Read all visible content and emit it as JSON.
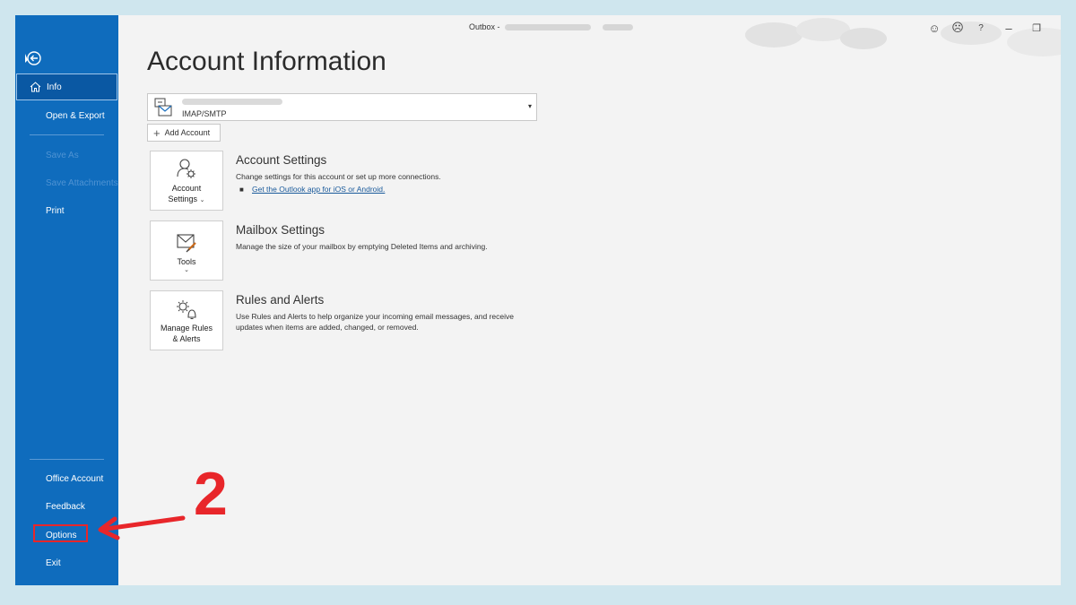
{
  "window": {
    "title_prefix": "Outbox -",
    "titlebar_icons": [
      {
        "name": "smiley-icon",
        "glyph": "☺"
      },
      {
        "name": "frown-icon",
        "glyph": "☹"
      },
      {
        "name": "help-icon",
        "glyph": "?"
      },
      {
        "name": "minimize-icon",
        "glyph": "–"
      },
      {
        "name": "restore-icon",
        "glyph": "❐"
      }
    ]
  },
  "sidebar": {
    "back_icon": "back-arrow-icon",
    "items": [
      {
        "label": "Info",
        "active": true
      },
      {
        "label": "Open & Export"
      },
      {
        "label": "Save As",
        "disabled": true
      },
      {
        "label": "Save Attachments",
        "disabled": true
      },
      {
        "label": "Print"
      }
    ],
    "bottom_items": [
      {
        "label": "Office Account"
      },
      {
        "label": "Feedback"
      },
      {
        "label": "Options",
        "highlighted": true
      },
      {
        "label": "Exit"
      }
    ]
  },
  "main": {
    "title": "Account Information",
    "account": {
      "type": "IMAP/SMTP"
    },
    "add_account_label": "Add Account",
    "sections": [
      {
        "tile_label_1": "Account",
        "tile_label_2": "Settings",
        "title": "Account Settings",
        "description": "Change settings for this account or set up more connections.",
        "link": "Get the Outlook app for iOS or Android."
      },
      {
        "tile_label_1": "Tools",
        "title": "Mailbox Settings",
        "description": "Manage the size of your mailbox by emptying Deleted Items and archiving."
      },
      {
        "tile_label_1": "Manage Rules",
        "tile_label_2": "& Alerts",
        "title": "Rules and Alerts",
        "description": "Use Rules and Alerts to help organize your incoming email messages, and receive updates when items are added, changed, or removed."
      }
    ]
  },
  "annotation": {
    "number": "2",
    "color": "#e8262a"
  },
  "colors": {
    "sidebar_bg": "#0f6cbd",
    "page_bg": "#cfe6ee",
    "link": "#1a5a9b"
  }
}
